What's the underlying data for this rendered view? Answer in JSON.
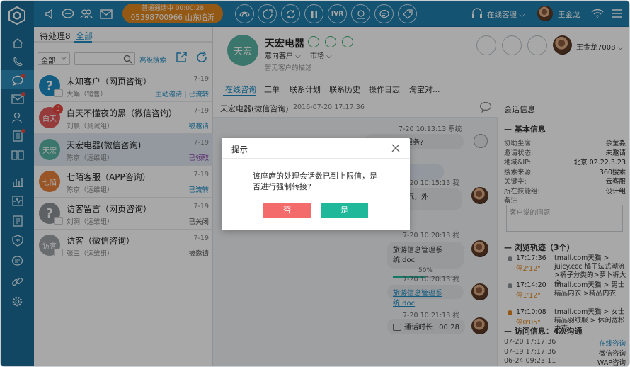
{
  "topbar": {
    "call_status": "普通通话中 00:00:28",
    "call_number": "05398700966 山东临沂",
    "ivr_label": "IVR",
    "agent_status": "在线客服",
    "user_name": "王金龙"
  },
  "list": {
    "tab_pending": "待处理8",
    "tab_all": "全部",
    "filter_value": "全部",
    "advanced_search": "高级搜索",
    "items": [
      {
        "name": "未知客户（网页咨询）",
        "sub": "大娟（销售）",
        "date": "7-19",
        "status": "主动邀请 | 已流转",
        "status_color": "#1d8cc4",
        "avatar": "?",
        "avatar_color": "#1d8cc4"
      },
      {
        "name": "白天不懂夜的黑（微信咨询）",
        "sub": "刘晨（测试组）",
        "date": "7-19",
        "status": "被邀请",
        "status_color": "#1d8cc4",
        "avatar": "白天",
        "avatar_color": "#e35a5a",
        "badge": "3"
      },
      {
        "name": "天宏电器(微信咨询)",
        "sub": "陈京（运维组）",
        "date": "7-19",
        "status": "已领取",
        "status_color": "#8e44ad",
        "avatar": "天宏",
        "avatar_color": "#58b3a3"
      },
      {
        "name": "七陌客服（APP咨询）",
        "sub": "陈京（运维组）",
        "date": "7-19",
        "status": "已流转",
        "status_color": "#1d8cc4",
        "avatar": "七陌",
        "avatar_color": "#e8823a"
      },
      {
        "name": "访客留言（网页咨询）",
        "sub": "刘洞（运维组）",
        "date": "7-19",
        "status": "已关闭",
        "status_color": "#555",
        "avatar": "?",
        "avatar_color": "#8f9396"
      },
      {
        "name": "访客（微信咨询）",
        "sub": "张三（运维组）",
        "date": "7-19",
        "status": "被邀请",
        "status_color": "#555",
        "avatar": "访客",
        "avatar_color": "#a0a4a7"
      }
    ]
  },
  "customer": {
    "name": "天宏电器",
    "avatar_text": "天宏",
    "intent": "意向客户",
    "market": "市场",
    "desc": "暂无客户的描述",
    "agent": "王金龙7008"
  },
  "tabs": [
    "在线咨询",
    "工单",
    "联系计划",
    "联系历史",
    "操作日志",
    "淘宝对..."
  ],
  "chat": {
    "header": "天宏电器(微信咨询)",
    "header_time": "2016-07-20 17:17:36",
    "messages": [
      {
        "ts": "7-20 10:13:13 系统",
        "text": "有什么可以服务?"
      },
      {
        "ts": "",
        "text": "网络不好。"
      },
      {
        "ts": "7-20 10:15:13 我",
        "text": "会有降雪天气，外"
      },
      {
        "ts": "7-20 10:20:13 我",
        "text": "旅游信息管理系统.doc",
        "progress": "50%",
        "progress_value": 0.5
      },
      {
        "ts": "7-20 10:20:13 我",
        "text": "旅游信息管理系统.doc"
      },
      {
        "ts": "7-20 10:21:13 我",
        "text": "通话时长",
        "duration": "00:28"
      }
    ]
  },
  "info": {
    "title": "会话信息",
    "basic_title": "基本信息",
    "rows": [
      {
        "k": "协助坐席:",
        "v": "余莹淼"
      },
      {
        "k": "邀请状态:",
        "v": "未邀请"
      },
      {
        "k": "地域&IP:",
        "v": "北京 02.22.3.23"
      },
      {
        "k": "搜索来源:",
        "v": "360搜索"
      },
      {
        "k": "关键字:",
        "v": "云客服"
      },
      {
        "k": "所在技能组:",
        "v": "设计组"
      },
      {
        "k": "备注",
        "v": ""
      }
    ],
    "note_placeholder": "客户说的问题",
    "browse_title": "浏览轨迹（3个）",
    "browse": [
      {
        "time": "17:17:36",
        "stay": "停2'12\"",
        "path": "tmall.com天猫 > juicy.ccc 橘子法式潮流 >裤子分类的>萝卜裤大全"
      },
      {
        "time": "17:14:20",
        "stay": "停1'12\"",
        "path": "tmall.com天猫 > 男士精品内衣 >精品内衣"
      },
      {
        "time": "17:10:08",
        "stay": "停0'05\"",
        "path": "tmall.com天猫 > 女士精品羽绒服 > 休闲宽松夹克"
      }
    ],
    "visit_title": "访问信息：4次沟通",
    "visits": [
      {
        "time": "07-20 17:17:36",
        "src": "在线咨询",
        "color": "#1d8cc4"
      },
      {
        "time": "07-19 17:17:36",
        "src": "微信咨询",
        "color": "#333"
      },
      {
        "time": "06-24 09:23:11",
        "src": "WAP咨询",
        "color": "#333"
      }
    ]
  },
  "dialog": {
    "title": "提示",
    "message": "该座席的处理会话数已到上限值，是否进行强制转接?",
    "no": "否",
    "yes": "是"
  },
  "colors": {
    "nav": "#1c6d97",
    "topbar": "#1f7fad",
    "accent": "#1d8cc4",
    "call": "#e0861e",
    "no": "#f36b6b",
    "yes": "#1fb89a"
  }
}
